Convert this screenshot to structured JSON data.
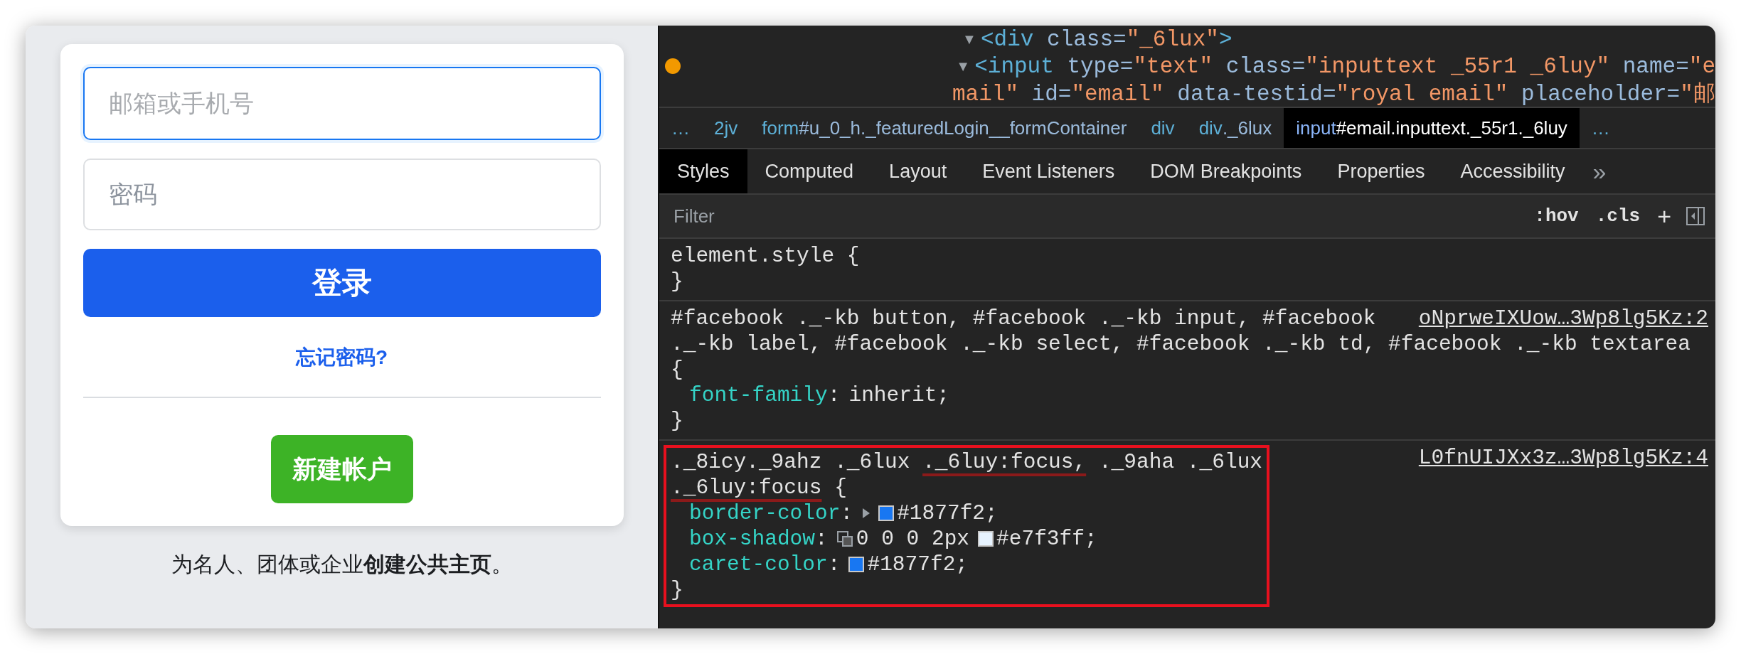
{
  "login": {
    "email": {
      "placeholder": "邮箱或手机号",
      "focused": true
    },
    "password": {
      "placeholder": "密码",
      "focused": false
    },
    "login_button": "登录",
    "forgot_link": "忘记密码?",
    "create_button": "新建帐户",
    "footer": "为名人、团体或企业**创建公共主页**。"
  },
  "devtools": {
    "dom_tree": [
      {
        "toggle": "▼",
        "tokens": [
          {
            "kind": "tag",
            "text": "<div"
          },
          {
            "kind": "attr",
            "text": " class="
          },
          {
            "kind": "value",
            "text": "\"_6lux\""
          },
          {
            "kind": "tag",
            "text": ">"
          }
        ],
        "children": [
          {
            "toggle": "▼",
            "breakpoint": true,
            "lines": [
              [
                {
                  "kind": "tag",
                  "text": "<input"
                },
                {
                  "kind": "attr",
                  "text": " type="
                },
                {
                  "kind": "value",
                  "text": "\"text\""
                },
                {
                  "kind": "attr",
                  "text": " class="
                },
                {
                  "kind": "value",
                  "text": "\"inputtext _55r1 _6luy\""
                },
                {
                  "kind": "attr",
                  "text": " name="
                },
                {
                  "kind": "value",
                  "text": "\"e"
                }
              ],
              [
                {
                  "kind": "value",
                  "text": "mail\""
                },
                {
                  "kind": "attr",
                  "text": " id="
                },
                {
                  "kind": "value",
                  "text": "\"email\""
                },
                {
                  "kind": "attr",
                  "text": " data-testid="
                },
                {
                  "kind": "value",
                  "text": "\"royal email\""
                },
                {
                  "kind": "attr",
                  "text": " placeholder="
                },
                {
                  "kind": "value",
                  "text": "\"邮"
                }
              ]
            ]
          }
        ]
      }
    ],
    "breadcrumbs": [
      {
        "tag": "…",
        "selected": false
      },
      {
        "tag": "2jv",
        "selected": false
      },
      {
        "tag": "form",
        "rest": "#u_0_h._featuredLogin__formContainer",
        "selected": false
      },
      {
        "tag": "div",
        "selected": false
      },
      {
        "tag": "div",
        "rest": "._6lux",
        "selected": false
      },
      {
        "tag": "input",
        "rest": "#email.inputtext._55r1._6luy",
        "selected": true
      },
      {
        "tag": "…",
        "selected": false
      }
    ],
    "tabs": [
      {
        "label": "Styles",
        "selected": true
      },
      {
        "label": "Computed",
        "selected": false
      },
      {
        "label": "Layout",
        "selected": false
      },
      {
        "label": "Event Listeners",
        "selected": false
      },
      {
        "label": "DOM Breakpoints",
        "selected": false
      },
      {
        "label": "Properties",
        "selected": false
      },
      {
        "label": "Accessibility",
        "selected": false
      }
    ],
    "more_tabs": "»",
    "filter": {
      "placeholder": "Filter",
      "hov": ":hov",
      "cls": ".cls",
      "add": "+"
    },
    "rules": [
      {
        "highlighted": false,
        "selector_lines": [
          [
            {
              "text": "element.style {",
              "marked": false
            }
          ]
        ],
        "close": "}"
      },
      {
        "source": "oNprweIXUow…3Wp8lg5Kz:2",
        "highlighted": false,
        "selector_lines": [
          [
            {
              "text": "#facebook ._-kb button, #facebook ._-kb input, #facebook",
              "marked": false
            }
          ],
          [
            {
              "text": "._-kb label, #facebook ._-kb select, #facebook ._-kb td, #facebook ._-kb textarea",
              "marked": false
            }
          ],
          [
            {
              "text": "{",
              "marked": false
            }
          ]
        ],
        "properties": [
          {
            "name": "font-family",
            "separator": ":",
            "parts": [
              {
                "kind": "text",
                "text": "inherit;"
              }
            ]
          }
        ],
        "close": "}"
      },
      {
        "source": "L0fnUIJXx3z…3Wp8lg5Kz:4",
        "highlighted": true,
        "selector_lines": [
          [
            {
              "text": "._8icy._9ahz ._6lux ",
              "marked": false
            },
            {
              "text": "._6luy:focus,",
              "marked": true
            },
            {
              "text": " ._9aha ._6lux",
              "marked": false
            }
          ],
          [
            {
              "text": "._6luy:focus",
              "marked": true
            },
            {
              "text": " {",
              "marked": false
            }
          ]
        ],
        "properties": [
          {
            "name": "border-color",
            "separator": ":",
            "parts": [
              {
                "kind": "expander"
              },
              {
                "kind": "swatch",
                "color": "#1877f2"
              },
              {
                "kind": "text",
                "text": "#1877f2;"
              }
            ]
          },
          {
            "name": "box-shadow",
            "separator": ":",
            "parts": [
              {
                "kind": "shadow-editor"
              },
              {
                "kind": "text",
                "text": "0 0 0 2px"
              },
              {
                "kind": "swatch",
                "color": "#e7f3ff"
              },
              {
                "kind": "text",
                "text": "#e7f3ff;"
              }
            ]
          },
          {
            "name": "caret-color",
            "separator": ":",
            "parts": [
              {
                "kind": "swatch",
                "color": "#1877f2"
              },
              {
                "kind": "text",
                "text": "#1877f2;"
              }
            ]
          }
        ],
        "close": "}"
      }
    ]
  }
}
